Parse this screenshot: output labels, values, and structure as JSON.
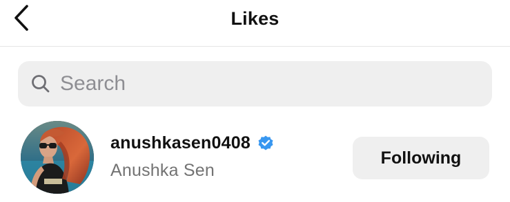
{
  "header": {
    "title": "Likes",
    "back_icon": "chevron-left-icon"
  },
  "search": {
    "placeholder": "Search",
    "value": "",
    "icon": "search-icon"
  },
  "likes": [
    {
      "username": "anushkasen0408",
      "full_name": "Anushka Sen",
      "verified": true,
      "verified_color": "#3897f0",
      "button_label": "Following",
      "avatar_icon": "profile-photo"
    }
  ],
  "colors": {
    "background": "#ffffff",
    "search_bg": "#efefef",
    "button_bg": "#efefef",
    "primary_text": "#111111",
    "secondary_text": "#737373",
    "placeholder": "#8e8e93",
    "divider": "#e6e6e6"
  }
}
